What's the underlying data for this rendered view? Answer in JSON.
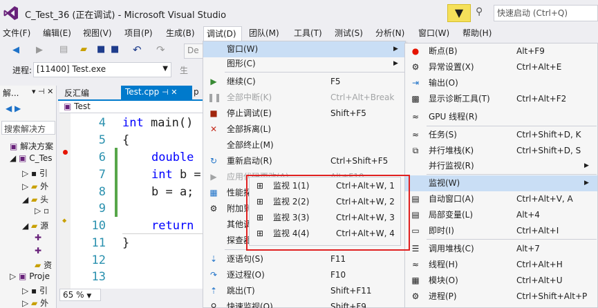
{
  "title_bar": {
    "title": "C_Test_36 (正在调试) - Microsoft Visual Studio",
    "quick_launch_placeholder": "快速启动 (Ctrl+Q)"
  },
  "menubar": [
    {
      "label": "文件(F)"
    },
    {
      "label": "编辑(E)"
    },
    {
      "label": "视图(V)"
    },
    {
      "label": "项目(P)"
    },
    {
      "label": "生成(B)"
    },
    {
      "label": "调试(D)"
    },
    {
      "label": "团队(M)"
    },
    {
      "label": "工具(T)"
    },
    {
      "label": "测试(S)"
    },
    {
      "label": "分析(N)"
    },
    {
      "label": "窗口(W)"
    },
    {
      "label": "帮助(H)"
    }
  ],
  "toolbar": {
    "config_value": "De",
    "process_label": "进程:",
    "process_value": "[11400] Test.exe",
    "right_label": "生"
  },
  "solution_explorer": {
    "title": "解...",
    "search_placeholder": "搜索解决方",
    "items": [
      {
        "label": "解决方案"
      },
      {
        "label": "C_Tes"
      },
      {
        "label": "引"
      },
      {
        "label": "外"
      },
      {
        "label": "头"
      },
      {
        "label": ""
      },
      {
        "label": "源"
      },
      {
        "label": ""
      },
      {
        "label": ""
      },
      {
        "label": "资"
      },
      {
        "label": "Proje"
      },
      {
        "label": "引"
      },
      {
        "label": "外"
      }
    ]
  },
  "editor": {
    "tab_disasm": "反汇编",
    "tab_active": "Test.cpp",
    "tab_next": "p",
    "nav_combo": "Test",
    "zoom": "65 %",
    "lines": [
      {
        "num": "4",
        "code": ""
      },
      {
        "num": "5",
        "code": "{"
      },
      {
        "num": "6",
        "code": ""
      },
      {
        "num": "7",
        "code": ""
      },
      {
        "num": "8",
        "code": "b = a;"
      },
      {
        "num": "9",
        "code": ""
      },
      {
        "num": "10",
        "code": ""
      },
      {
        "num": "11",
        "code": "}"
      },
      {
        "num": "12",
        "code": ""
      },
      {
        "num": "13",
        "code": ""
      }
    ],
    "line4": {
      "kw": "int",
      "rest": " main()"
    },
    "line6": {
      "kw": "double"
    },
    "line7": {
      "kw": "int",
      "rest": " b ="
    },
    "line10": {
      "kw": "return"
    }
  },
  "debug_menu": [
    {
      "label": "窗口(W)",
      "shortcut": "",
      "icon": "none"
    },
    {
      "label": "图形(C)",
      "shortcut": "",
      "icon": "none"
    },
    {
      "label": "继续(C)",
      "shortcut": "F5",
      "icon": "play-icon"
    },
    {
      "label": "全部中断(K)",
      "shortcut": "Ctrl+Alt+Break",
      "icon": "pause-icon"
    },
    {
      "label": "停止调试(E)",
      "shortcut": "Shift+F5",
      "icon": "stop-icon"
    },
    {
      "label": "全部拆离(L)",
      "shortcut": "",
      "icon": "detach-icon"
    },
    {
      "label": "全部终止(M)",
      "shortcut": "",
      "icon": "none"
    },
    {
      "label": "重新启动(R)",
      "shortcut": "Ctrl+Shift+F5",
      "icon": "restart-icon"
    },
    {
      "label": "应用代码更改(A)",
      "shortcut": "Alt+F10",
      "icon": "apply-icon"
    },
    {
      "label": "性能探",
      "shortcut": "",
      "icon": "perf-icon"
    },
    {
      "label": "附加到",
      "shortcut": "",
      "icon": "attach-icon"
    },
    {
      "label": "其他调",
      "shortcut": "",
      "icon": "none"
    },
    {
      "label": "探查器",
      "shortcut": "",
      "icon": "none"
    },
    {
      "label": "逐语句(S)",
      "shortcut": "F11",
      "icon": "step-into-icon"
    },
    {
      "label": "逐过程(O)",
      "shortcut": "F10",
      "icon": "step-over-icon"
    },
    {
      "label": "跳出(T)",
      "shortcut": "Shift+F11",
      "icon": "step-out-icon"
    },
    {
      "label": "快速监视(Q)",
      "shortcut": "Shift+F9",
      "icon": "quickwatch-icon"
    }
  ],
  "window_menu": [
    {
      "label": "断点(B)",
      "shortcut": "Alt+F9"
    },
    {
      "label": "异常设置(X)",
      "shortcut": "Ctrl+Alt+E"
    },
    {
      "label": "输出(O)",
      "shortcut": ""
    },
    {
      "label": "显示诊断工具(T)",
      "shortcut": "Ctrl+Alt+F2"
    },
    {
      "label": "GPU 线程(R)",
      "shortcut": ""
    },
    {
      "label": "任务(S)",
      "shortcut": "Ctrl+Shift+D, K"
    },
    {
      "label": "并行堆栈(K)",
      "shortcut": "Ctrl+Shift+D, S"
    },
    {
      "label": "并行监视(R)",
      "shortcut": ""
    },
    {
      "label": "监视(W)",
      "shortcut": ""
    },
    {
      "label": "自动窗口(A)",
      "shortcut": "Ctrl+Alt+V, A"
    },
    {
      "label": "局部变量(L)",
      "shortcut": "Alt+4"
    },
    {
      "label": "即时(I)",
      "shortcut": "Ctrl+Alt+I"
    },
    {
      "label": "调用堆栈(C)",
      "shortcut": "Alt+7"
    },
    {
      "label": "线程(H)",
      "shortcut": "Ctrl+Alt+H"
    },
    {
      "label": "模块(O)",
      "shortcut": "Ctrl+Alt+U"
    },
    {
      "label": "进程(P)",
      "shortcut": "Ctrl+Shift+Alt+P"
    }
  ],
  "watch_menu": [
    {
      "label": "监视 1(1)",
      "shortcut": "Ctrl+Alt+W, 1"
    },
    {
      "label": "监视 2(2)",
      "shortcut": "Ctrl+Alt+W, 2"
    },
    {
      "label": "监视 3(3)",
      "shortcut": "Ctrl+Alt+W, 3"
    },
    {
      "label": "监视 4(4)",
      "shortcut": "Ctrl+Alt+W, 4"
    }
  ],
  "colors": {
    "accent": "#007acc",
    "highlight": "#c9def5",
    "annotation_box": "#e02020"
  }
}
